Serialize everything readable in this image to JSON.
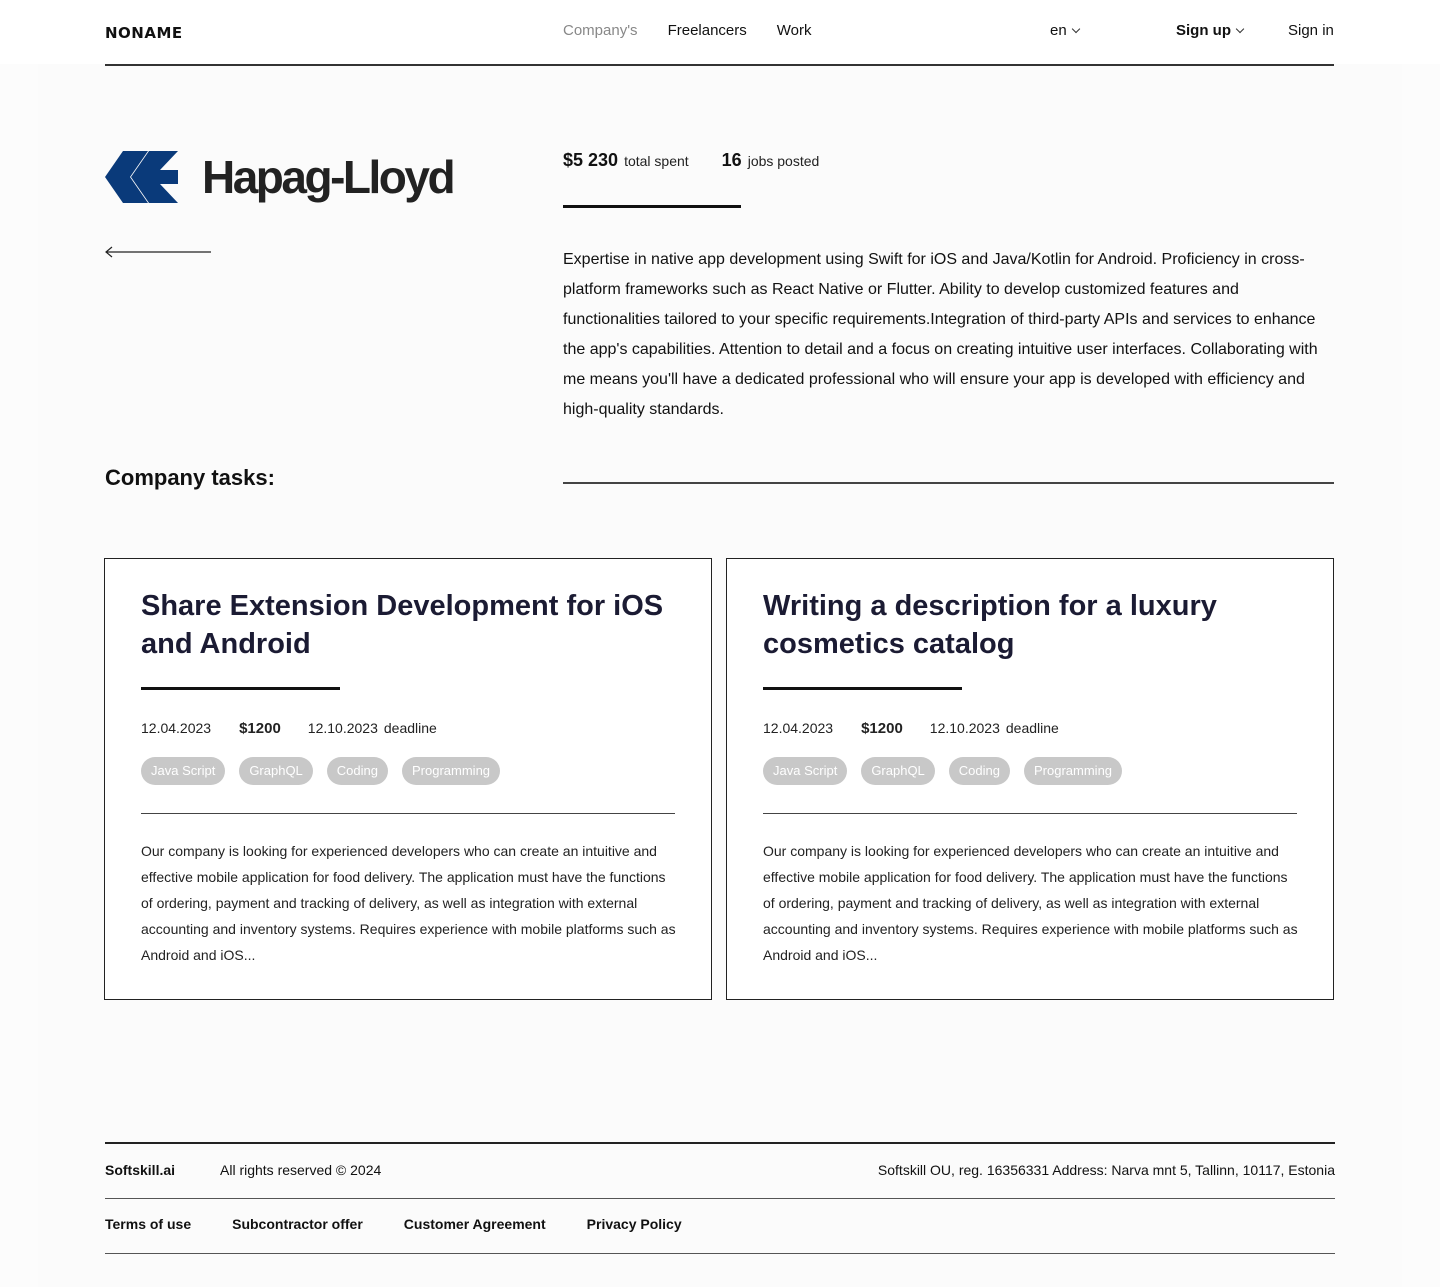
{
  "header": {
    "logo": "NONAME",
    "nav": [
      "Company's",
      "Freelancers",
      "Work"
    ],
    "lang": "en",
    "signup": "Sign up",
    "signin": "Sign in"
  },
  "company": {
    "name": "Hapag-Lloyd",
    "logo_color": "#0a3a7a",
    "total_spent": "$5 230",
    "total_spent_label": "total spent",
    "jobs_posted": "16",
    "jobs_posted_label": "jobs posted",
    "description": "Expertise in native app development using Swift for iOS and Java/Kotlin for Android. Proficiency in cross-platform frameworks such as React Native or Flutter. Ability to develop customized features and functionalities tailored to your specific requirements.Integration of third-party APIs and services to enhance the app's capabilities. Attention to detail and a focus on creating intuitive user interfaces. Collaborating with me means you'll have a dedicated professional who will ensure your app is developed with efficiency and high-quality standards."
  },
  "tasks_title": "Company tasks:",
  "tasks": [
    {
      "title": "Share Extension Development for iOS and Android",
      "date": "12.04.2023",
      "price": "$1200",
      "deadline_date": "12.10.2023",
      "deadline_label": "deadline",
      "tags": [
        "Java Script",
        "GraphQL",
        "Coding",
        "Programming"
      ],
      "text": "Our company is looking for experienced developers who can create an intuitive and effective mobile application for food delivery. The application must have the functions of ordering, payment and tracking of delivery, as well as integration with external accounting and inventory systems. Requires experience with mobile platforms such as Android and iOS..."
    },
    {
      "title": "Writing a description for a luxury cosmetics catalog",
      "date": "12.04.2023",
      "price": "$1200",
      "deadline_date": "12.10.2023",
      "deadline_label": "deadline",
      "tags": [
        "Java Script",
        "GraphQL",
        "Coding",
        "Programming"
      ],
      "text": "Our company is looking for experienced developers who can create an intuitive and effective mobile application for food delivery. The application must have the functions of ordering, payment and tracking of delivery, as well as integration with external accounting and inventory systems. Requires experience with mobile platforms such as Android and iOS..."
    }
  ],
  "footer": {
    "brand": "Softskill.ai",
    "rights": "All rights reserved © 2024",
    "address": "Softskill OU, reg. 16356331 Address: Narva mnt 5, Tallinn, 10117, Estonia",
    "links": [
      "Terms of use",
      "Subcontractor offer",
      "Customer Agreement",
      "Privacy Policy"
    ]
  }
}
